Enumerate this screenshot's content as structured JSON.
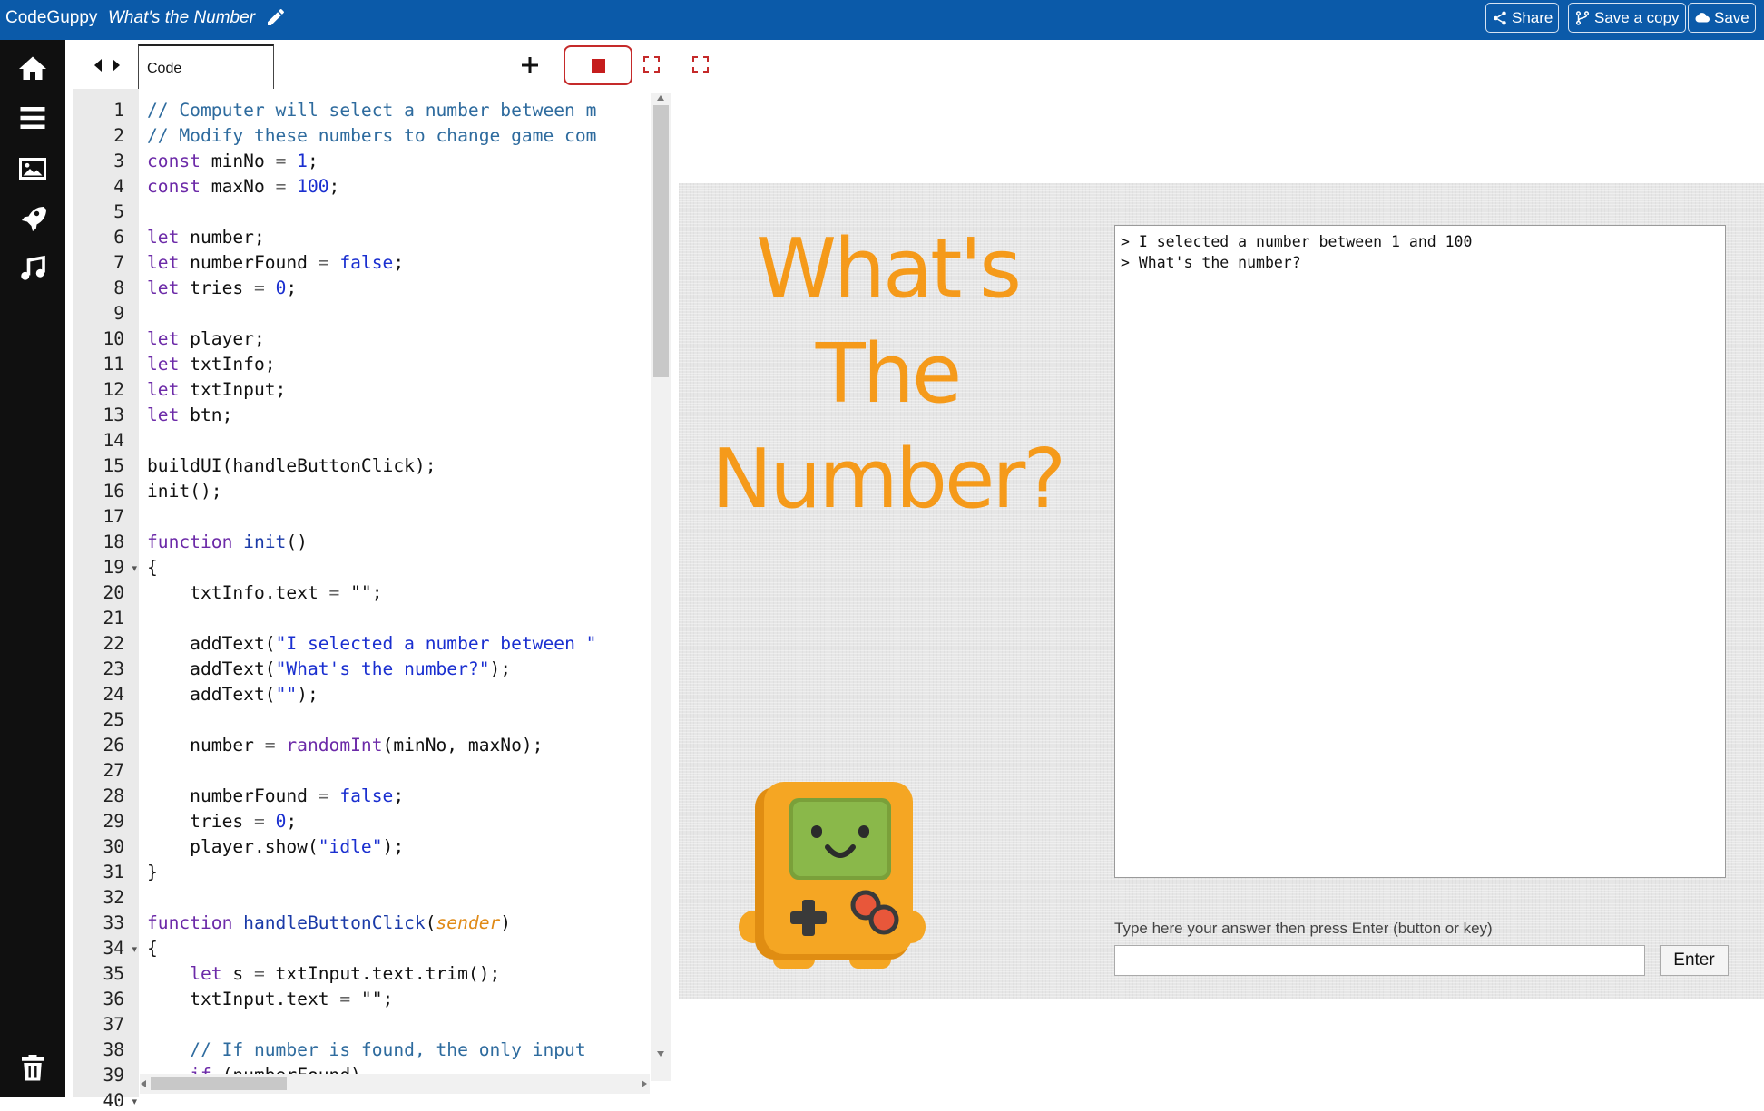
{
  "topbar": {
    "brand": "CodeGuppy",
    "project_title": "What's the Number",
    "share_label": "Share",
    "save_copy_label": "Save a copy",
    "save_label": "Save",
    "color": "#0b5aa9"
  },
  "leftnav": {
    "items": [
      "home-icon",
      "menu-icon",
      "image-icon",
      "rocket-icon",
      "music-icon"
    ],
    "bottom": "trash-icon"
  },
  "editor": {
    "tab_label": "Code",
    "line_numbers": [
      "1",
      "2",
      "3",
      "4",
      "5",
      "6",
      "7",
      "8",
      "9",
      "10",
      "11",
      "12",
      "13",
      "14",
      "15",
      "16",
      "17",
      "18",
      "19",
      "20",
      "21",
      "22",
      "23",
      "24",
      "25",
      "26",
      "27",
      "28",
      "29",
      "30",
      "31",
      "32",
      "33",
      "34",
      "35",
      "36",
      "37",
      "38",
      "39",
      "40"
    ],
    "code": [
      [
        [
          "c",
          "// Computer will select a number between m"
        ]
      ],
      [
        [
          "c",
          "// Modify these numbers to change game com"
        ]
      ],
      [
        [
          "k",
          "const"
        ],
        [
          "t",
          " minNo "
        ],
        [
          "o",
          "="
        ],
        [
          "t",
          " "
        ],
        [
          "n",
          "1"
        ],
        [
          "t",
          ";"
        ]
      ],
      [
        [
          "k",
          "const"
        ],
        [
          "t",
          " maxNo "
        ],
        [
          "o",
          "="
        ],
        [
          "t",
          " "
        ],
        [
          "n",
          "100"
        ],
        [
          "t",
          ";"
        ]
      ],
      [],
      [
        [
          "k",
          "let"
        ],
        [
          "t",
          " number;"
        ]
      ],
      [
        [
          "k",
          "let"
        ],
        [
          "t",
          " numberFound "
        ],
        [
          "o",
          "="
        ],
        [
          "t",
          " "
        ],
        [
          "n",
          "false"
        ],
        [
          "t",
          ";"
        ]
      ],
      [
        [
          "k",
          "let"
        ],
        [
          "t",
          " tries "
        ],
        [
          "o",
          "="
        ],
        [
          "t",
          " "
        ],
        [
          "n",
          "0"
        ],
        [
          "t",
          ";"
        ]
      ],
      [],
      [
        [
          "k",
          "let"
        ],
        [
          "t",
          " player;"
        ]
      ],
      [
        [
          "k",
          "let"
        ],
        [
          "t",
          " txtInfo;"
        ]
      ],
      [
        [
          "k",
          "let"
        ],
        [
          "t",
          " txtInput;"
        ]
      ],
      [
        [
          "k",
          "let"
        ],
        [
          "t",
          " btn;"
        ]
      ],
      [],
      [
        [
          "t",
          "buildUI(handleButtonClick);"
        ]
      ],
      [
        [
          "t",
          "init();"
        ]
      ],
      [],
      [
        [
          "k",
          "function"
        ],
        [
          "t",
          " "
        ],
        [
          "f",
          "init"
        ],
        [
          "t",
          "()"
        ]
      ],
      [
        [
          "t",
          "{"
        ]
      ],
      [
        [
          "t",
          "    txtInfo.text "
        ],
        [
          "o",
          "="
        ],
        [
          "t",
          " \"\";"
        ]
      ],
      [],
      [
        [
          "t",
          "    addText("
        ],
        [
          "s",
          "\"I selected a number between \""
        ]
      ],
      [
        [
          "t",
          "    addText("
        ],
        [
          "s",
          "\"What's the number?\""
        ],
        [
          "t",
          ");"
        ]
      ],
      [
        [
          "t",
          "    addText("
        ],
        [
          "s",
          "\"\""
        ],
        [
          "t",
          ");"
        ]
      ],
      [],
      [
        [
          "t",
          "    number "
        ],
        [
          "o",
          "="
        ],
        [
          "t",
          " "
        ],
        [
          "f2",
          "randomInt"
        ],
        [
          "t",
          "(minNo, maxNo);"
        ]
      ],
      [],
      [
        [
          "t",
          "    numberFound "
        ],
        [
          "o",
          "="
        ],
        [
          "t",
          " "
        ],
        [
          "n",
          "false"
        ],
        [
          "t",
          ";"
        ]
      ],
      [
        [
          "t",
          "    tries "
        ],
        [
          "o",
          "="
        ],
        [
          "t",
          " "
        ],
        [
          "n",
          "0"
        ],
        [
          "t",
          ";"
        ]
      ],
      [
        [
          "t",
          "    player.show("
        ],
        [
          "s",
          "\"idle\""
        ],
        [
          "t",
          ");"
        ]
      ],
      [
        [
          "t",
          "}"
        ]
      ],
      [],
      [
        [
          "k",
          "function"
        ],
        [
          "t",
          " "
        ],
        [
          "f",
          "handleButtonClick"
        ],
        [
          "t",
          "("
        ],
        [
          "p",
          "sender"
        ],
        [
          "t",
          ")"
        ]
      ],
      [
        [
          "t",
          "{"
        ]
      ],
      [
        [
          "t",
          "    "
        ],
        [
          "k",
          "let"
        ],
        [
          "t",
          " s "
        ],
        [
          "o",
          "="
        ],
        [
          "t",
          " txtInput.text.trim();"
        ]
      ],
      [
        [
          "t",
          "    txtInput.text "
        ],
        [
          "o",
          "="
        ],
        [
          "t",
          " \"\";"
        ]
      ],
      [],
      [
        [
          "c",
          "    // If number is found, the only input"
        ]
      ],
      [
        [
          "t",
          "    "
        ],
        [
          "k",
          "if"
        ],
        [
          "t",
          " (numberFound)"
        ]
      ],
      [
        [
          "t",
          "    {"
        ]
      ]
    ],
    "fold_lines": [
      19,
      34,
      40
    ]
  },
  "game": {
    "title_lines": [
      "What's",
      "The",
      "Number?"
    ],
    "title_color": "#f59a1a",
    "log_lines": [
      "> I selected a number between 1 and 100",
      "> What's the number?"
    ],
    "prompt_label": "Type here your answer then press Enter (button or key)",
    "input_value": "",
    "enter_label": "Enter"
  }
}
